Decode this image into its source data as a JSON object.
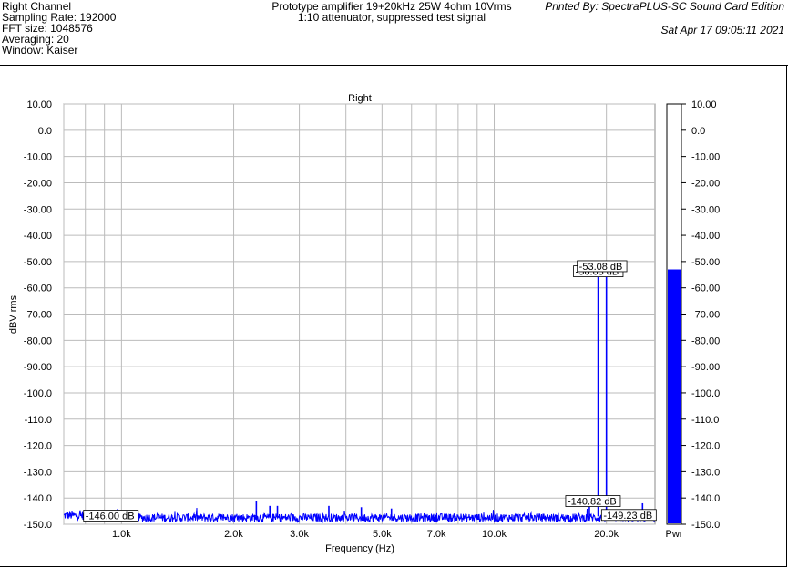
{
  "header": {
    "left_lines": [
      "Right Channel",
      "Sampling Rate: 192000",
      "FFT size: 1048576",
      "Averaging: 20",
      "Window: Kaiser"
    ],
    "title_lines": [
      "Prototype amplifier 19+20kHz 25W 4ohm 10Vrms",
      "1:10 attenuator, suppressed test signal"
    ],
    "printed_by": "Printed By: SpectraPLUS-SC Sound Card Edition",
    "date": "Sat Apr 17 09:05:11 2021"
  },
  "chart_data": {
    "type": "line",
    "title": "Right",
    "xlabel": "Frequency (Hz)",
    "ylabel": "dBV rms",
    "x_scale": "log",
    "xlim": [
      700,
      27000
    ],
    "ylim": [
      -150,
      10
    ],
    "grid": true,
    "x_ticks": [
      {
        "value": 1000,
        "label": "1.0k"
      },
      {
        "value": 2000,
        "label": "2.0k"
      },
      {
        "value": 3000,
        "label": "3.0k"
      },
      {
        "value": 5000,
        "label": "5.0k"
      },
      {
        "value": 7000,
        "label": "7.0k"
      },
      {
        "value": 10000,
        "label": "10.0k"
      },
      {
        "value": 20000,
        "label": "20.0k"
      }
    ],
    "y_ticks": [
      {
        "value": 10,
        "label": "10.00"
      },
      {
        "value": 0,
        "label": "0.0"
      },
      {
        "value": -10,
        "label": "-10.00"
      },
      {
        "value": -20,
        "label": "-20.00"
      },
      {
        "value": -30,
        "label": "-30.00"
      },
      {
        "value": -40,
        "label": "-40.00"
      },
      {
        "value": -50,
        "label": "-50.00"
      },
      {
        "value": -60,
        "label": "-60.00"
      },
      {
        "value": -70,
        "label": "-70.00"
      },
      {
        "value": -80,
        "label": "-80.00"
      },
      {
        "value": -90,
        "label": "-90.00"
      },
      {
        "value": -100,
        "label": "-100.0"
      },
      {
        "value": -110,
        "label": "-110.0"
      },
      {
        "value": -120,
        "label": "-120.0"
      },
      {
        "value": -130,
        "label": "-130.0"
      },
      {
        "value": -140,
        "label": "-140.0"
      },
      {
        "value": -150,
        "label": "-150.0"
      }
    ],
    "series": [
      {
        "color": "#0000ff",
        "noise_floor_db": -147.5,
        "spikes": [
          {
            "x": 2300,
            "y": -141
          },
          {
            "x": 2500,
            "y": -143
          },
          {
            "x": 2620,
            "y": -143
          },
          {
            "x": 3600,
            "y": -143
          },
          {
            "x": 4400,
            "y": -143.5
          },
          {
            "x": 5300,
            "y": -144
          },
          {
            "x": 18000,
            "y": -141
          },
          {
            "x": 19000,
            "y": -53.5
          },
          {
            "x": 20000,
            "y": -53.5
          },
          {
            "x": 25000,
            "y": -142
          }
        ]
      }
    ],
    "annotations": [
      {
        "x": 19000,
        "y": -56.5,
        "label": "-56.63 dB"
      },
      {
        "x": 20000,
        "y": -53.5,
        "label": "-53.08 dB"
      },
      {
        "x": 18000,
        "y": -140.82,
        "label": "-140.82 dB"
      },
      {
        "x": 800,
        "y": -146.0,
        "label": "-146.00 dB"
      },
      {
        "x": 21000,
        "y": -149.23,
        "label": "-149.23 dB"
      }
    ],
    "meter": {
      "label": "Pwr",
      "level_db": -53,
      "fill_color": "#0000ff",
      "ylim": [
        -150,
        10
      ],
      "tick_labels": [
        "10.00",
        "0.0",
        "-10.00",
        "-20.00",
        "-30.00",
        "-40.00",
        "-50.00",
        "-60.00",
        "-70.00",
        "-80.00",
        "-90.00",
        "-100.0",
        "-110.0",
        "-120.0",
        "-130.0",
        "-140.0",
        "-150.0"
      ]
    }
  }
}
